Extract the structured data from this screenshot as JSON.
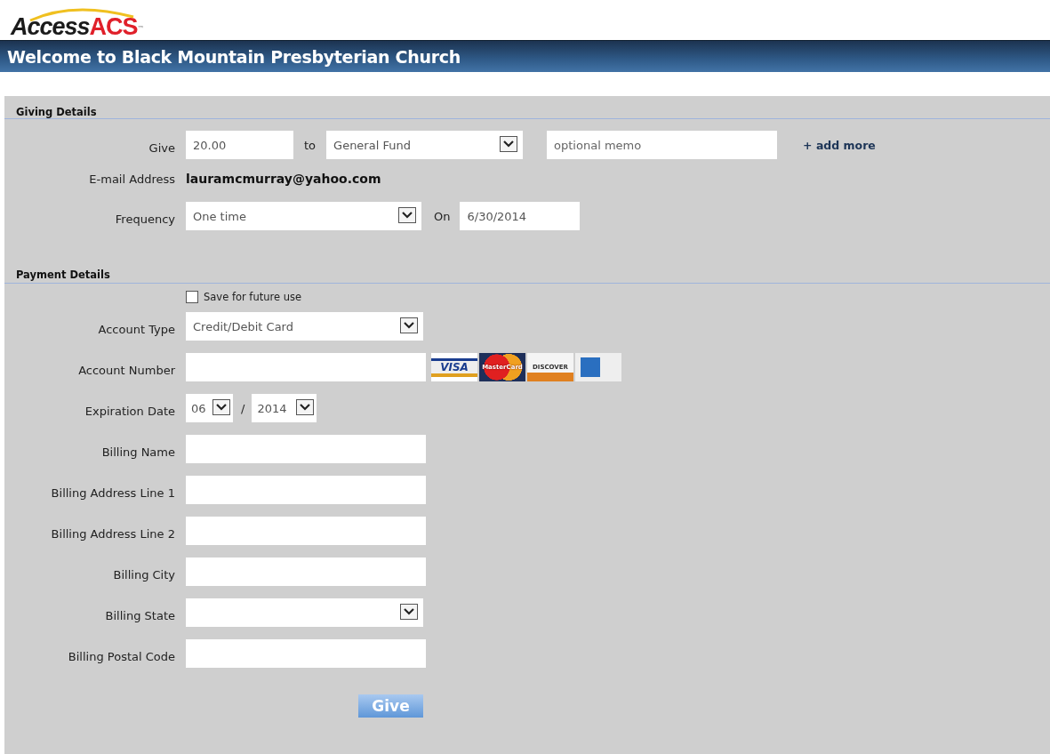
{
  "logo": {
    "text_dark": "Access",
    "text_accent": "ACS",
    "trademark": "™"
  },
  "header": {
    "title": "Welcome to Black Mountain Presbyterian Church"
  },
  "giving_details": {
    "title": "Giving Details",
    "give": {
      "label": "Give",
      "amount": "20.00",
      "to_label": "to",
      "fund": "General Fund",
      "memo_placeholder": "optional memo",
      "add_more": "+ add more"
    },
    "email": {
      "label": "E-mail Address",
      "value": "lauramcmurray@yahoo.com"
    },
    "frequency": {
      "label": "Frequency",
      "value": "One time",
      "on_label": "On",
      "date": "6/30/2014"
    }
  },
  "payment_details": {
    "title": "Payment Details",
    "save": {
      "label": "Save for future use",
      "checked": false
    },
    "fields": [
      {
        "label": "Account Type",
        "kind": "select",
        "value": "Credit/Debit Card"
      },
      {
        "label": "Account Number",
        "kind": "card",
        "cards": [
          {
            "kind": "visa",
            "text": "VISA"
          },
          {
            "kind": "mastercard",
            "text": "MasterCard"
          },
          {
            "kind": "discover",
            "text": "DISCOVER"
          },
          {
            "kind": "amex"
          }
        ]
      },
      {
        "label": "Expiration Date",
        "kind": "expiry",
        "month": "06",
        "separator": "/",
        "year": "2014"
      },
      {
        "label": "Billing Name",
        "kind": "text"
      },
      {
        "label": "Billing Address Line 1",
        "kind": "text"
      },
      {
        "label": "Billing Address Line 2",
        "kind": "text"
      },
      {
        "label": "Billing City",
        "kind": "text"
      },
      {
        "label": "Billing State",
        "kind": "select"
      },
      {
        "label": "Billing Postal Code",
        "kind": "text"
      }
    ]
  },
  "submit": {
    "label": "Give"
  }
}
